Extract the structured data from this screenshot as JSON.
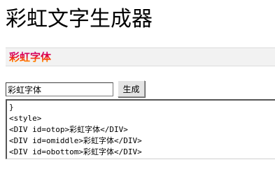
{
  "page": {
    "title": "彩虹文字生成器"
  },
  "preview": {
    "text": "彩虹字体"
  },
  "form": {
    "input_value": "彩虹字体",
    "generate_label": "生成"
  },
  "code_output": {
    "lines": [
      "}",
      "<style>",
      "<DIV id=otop>彩虹字体</DIV>",
      "<DIV id=omiddle>彩虹字体</DIV>",
      "<DIV id=obottom>彩虹字体</DIV>"
    ]
  },
  "colors": {
    "rainbow_top": "#c8008c",
    "rainbow_mid": "#ff5a00",
    "rainbow_bottom": "#ffd400"
  }
}
